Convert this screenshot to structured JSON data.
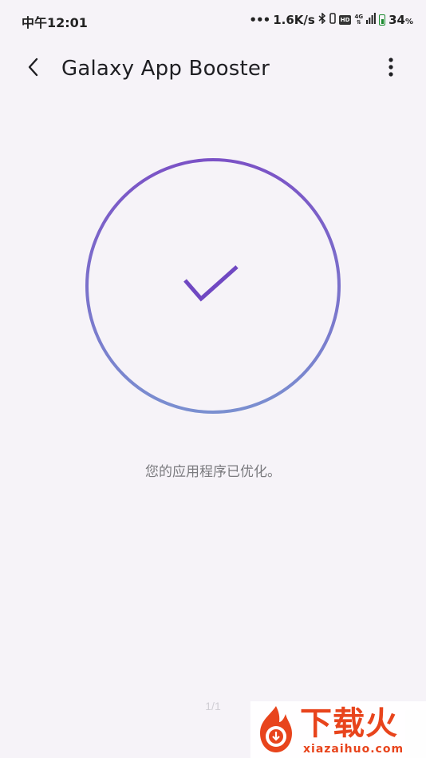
{
  "status_bar": {
    "time": "中午12:01",
    "network_speed": "1.6K/s",
    "hd_badge": "HD",
    "network_type": "4G",
    "battery": "34",
    "battery_unit": "%"
  },
  "header": {
    "title": "Galaxy App Booster",
    "back_icon": "chevron-left-icon",
    "more_icon": "more-vertical-icon"
  },
  "main": {
    "result_message": "您的应用程序已优化。",
    "check_icon": "checkmark-icon",
    "ring_gradient": [
      "#7b52c6",
      "#7a8fd0"
    ],
    "check_color": "#7048c2"
  },
  "footer": {
    "page_indicator": "1/1"
  },
  "watermark": {
    "brand_cn": "下载火",
    "brand_en": "xiazaihuo.com",
    "brand_color": "#e8441c"
  }
}
